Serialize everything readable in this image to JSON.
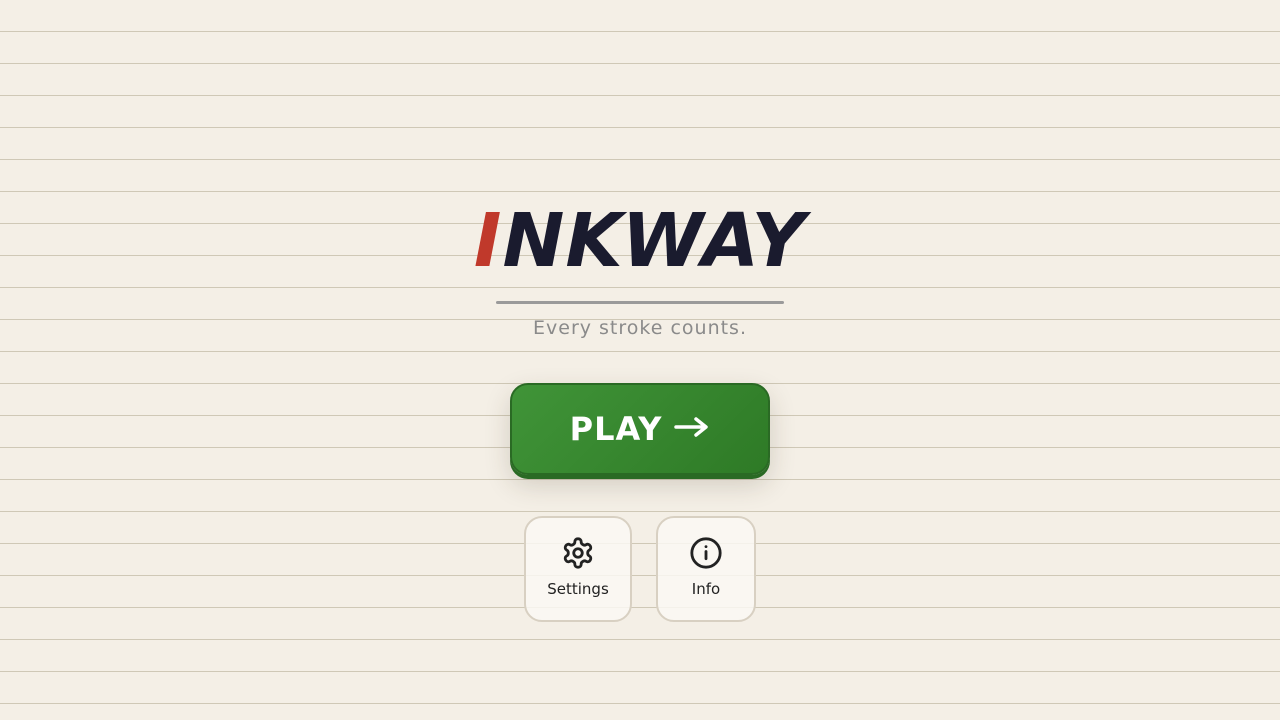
{
  "title": {
    "first_letter": "I",
    "rest": "NKWAY",
    "first_letter_color": "#c0392b",
    "rest_color": "#1a1b2e"
  },
  "subtitle": "Every stroke counts.",
  "play_button": {
    "label": "PLAY",
    "icon": "arrow-right-icon",
    "color": "#3a8a32"
  },
  "menu": [
    {
      "label": "Settings",
      "icon": "gear-icon"
    },
    {
      "label": "Info",
      "icon": "info-icon"
    }
  ],
  "background": {
    "paper_color": "#f4efe6",
    "line_color": "#cfc8b6"
  }
}
